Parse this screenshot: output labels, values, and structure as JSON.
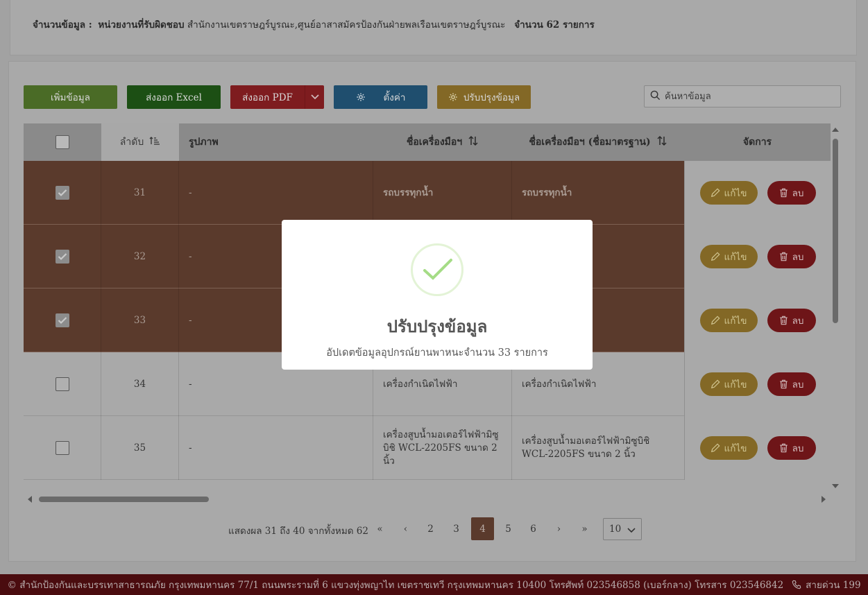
{
  "info": {
    "label": "จำนวนข้อมูล :",
    "agency_label": "หน่วยงานที่รับผิดชอบ",
    "agency_value": "สำนักงานเขตราษฎร์บูรณะ,ศูนย์อาสาสมัครป้องกันฝ่ายพลเรือนเขตราษฎร์บูรณะ",
    "count_text": "จำนวน 62 รายการ"
  },
  "toolbar": {
    "add_label": "เพิ่มข้อมูล",
    "excel_label": "ส่งออก Excel",
    "pdf_label": "ส่งออก PDF",
    "settings_label": "ตั้งค่า",
    "update_label": "ปรับปรุงข้อมูล",
    "search_placeholder": "ค้นหาข้อมูล"
  },
  "table": {
    "headers": {
      "order": "ลำดับ",
      "image": "รูปภาพ",
      "name": "ชื่อเครื่องมือฯ",
      "std_name": "ชื่อเครื่องมือฯ (ชื่อมาตรฐาน)",
      "manage": "จัดการ"
    },
    "edit_label": "แก้ไข",
    "delete_label": "ลบ",
    "rows": [
      {
        "order": "31",
        "image": "-",
        "name": "รถบรรทุกน้ำ",
        "std_name": "รถบรรทุกน้ำ",
        "checked": true
      },
      {
        "order": "32",
        "image": "-",
        "name": "",
        "std_name": "",
        "checked": true
      },
      {
        "order": "33",
        "image": "-",
        "name": "",
        "std_name": "",
        "checked": true
      },
      {
        "order": "34",
        "image": "-",
        "name": "เครื่องกำเนิดไฟฟ้า",
        "std_name": "เครื่องกำเนิดไฟฟ้า",
        "checked": false
      },
      {
        "order": "35",
        "image": "-",
        "name": "เครื่องสูบน้ำมอเตอร์ไฟฟ้ามิซูบิชิ WCL-2205FS ขนาด 2 นิ้ว",
        "std_name": "เครื่องสูบน้ำมอเตอร์ไฟฟ้ามิซูบิชิ WCL-2205FS ขนาด 2 นิ้ว",
        "checked": false
      }
    ]
  },
  "pagination": {
    "info": "แสดงผล 31 ถึง 40 จากทั้งหมด 62",
    "first": "«",
    "prev": "‹",
    "pages": [
      "2",
      "3",
      "4",
      "5",
      "6"
    ],
    "active_page": "4",
    "next": "›",
    "last": "»",
    "page_size": "10"
  },
  "footer": {
    "address": "© สำนักป้องกันและบรรเทาสาธารณภัย กรุงเทพมหานคร 77/1 ถนนพระรามที่ 6 แขวงทุ่งพญาไท เขตราชเทวี กรุงเทพมหานคร 10400 โทรศัพท์ 023546858 (เบอร์กลาง) โทรสาร 023546842",
    "hotline": "สายด่วน 199"
  },
  "modal": {
    "icon": "success-check-icon",
    "title": "ปรับปรุงข้อมูล",
    "message": "อัปเดตข้อมูลอุปกรณ์ยานพาหนะจำนวน 33 รายการ"
  }
}
